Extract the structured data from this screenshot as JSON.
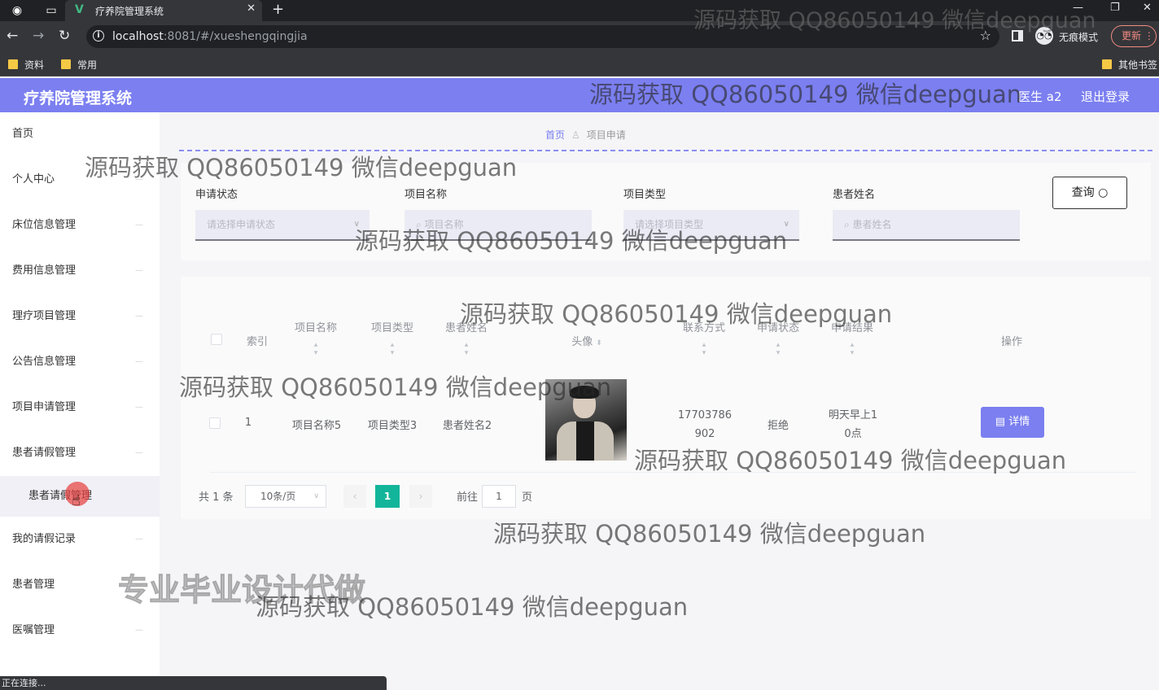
{
  "browser": {
    "tab_title": "疗养院管理系统",
    "tab_logo": "V",
    "url_host": "localhost",
    "url_rest": ":8081/#/xueshengqingjia",
    "incognito_label": "无痕模式",
    "update_label": "更新",
    "bookmarks": [
      "资料",
      "常用",
      "其他书签"
    ],
    "status_text": "正在连接..."
  },
  "header": {
    "title": "疗养院管理系统",
    "user": "医生 a2",
    "logout": "退出登录"
  },
  "sidebar": {
    "items": [
      {
        "label": "首页"
      },
      {
        "label": "个人中心"
      },
      {
        "label": "床位信息管理"
      },
      {
        "label": "费用信息管理"
      },
      {
        "label": "理疗项目管理"
      },
      {
        "label": "公告信息管理"
      },
      {
        "label": "项目申请管理"
      },
      {
        "label": "患者请假管理"
      },
      {
        "label": "我的请假记录"
      },
      {
        "label": "患者管理"
      },
      {
        "label": "医嘱管理"
      }
    ],
    "subitem": "患者请假管理"
  },
  "breadcrumb": {
    "home": "首页",
    "current": "项目申请"
  },
  "filters": [
    {
      "label": "申请状态",
      "placeholder": "请选择申请状态"
    },
    {
      "label": "项目名称",
      "placeholder": "项目名称"
    },
    {
      "label": "项目类型",
      "placeholder": "请选择项目类型"
    },
    {
      "label": "患者姓名",
      "placeholder": "患者姓名"
    }
  ],
  "search_button": "查询",
  "table": {
    "headers": {
      "index": "索引",
      "project_name": "项目名称",
      "project_type": "项目类型",
      "patient_name": "患者姓名",
      "avatar": "头像",
      "contact": "联系方式",
      "apply_status": "申请状态",
      "apply_result": "申请结果",
      "actions": "操作"
    },
    "rows": [
      {
        "index": "1",
        "project_name": "项目名称5",
        "project_type": "项目类型3",
        "patient_name": "患者姓名2",
        "contact_line1": "17703786",
        "contact_line2": "902",
        "apply_status": "拒绝",
        "apply_result_line1": "明天早上1",
        "apply_result_line2": "0点",
        "detail_label": "详情"
      }
    ]
  },
  "pagination": {
    "total": "共 1 条",
    "page_size": "10条/页",
    "current_page": "1",
    "goto_label": "前往",
    "goto_value": "1",
    "page_suffix": "页"
  },
  "watermark": {
    "text": "源码获取 QQ86050149 微信deepguan",
    "banner": "专业毕业设计代做"
  },
  "colors": {
    "accent": "#7b7ff0",
    "pager_active": "#13b59a"
  }
}
